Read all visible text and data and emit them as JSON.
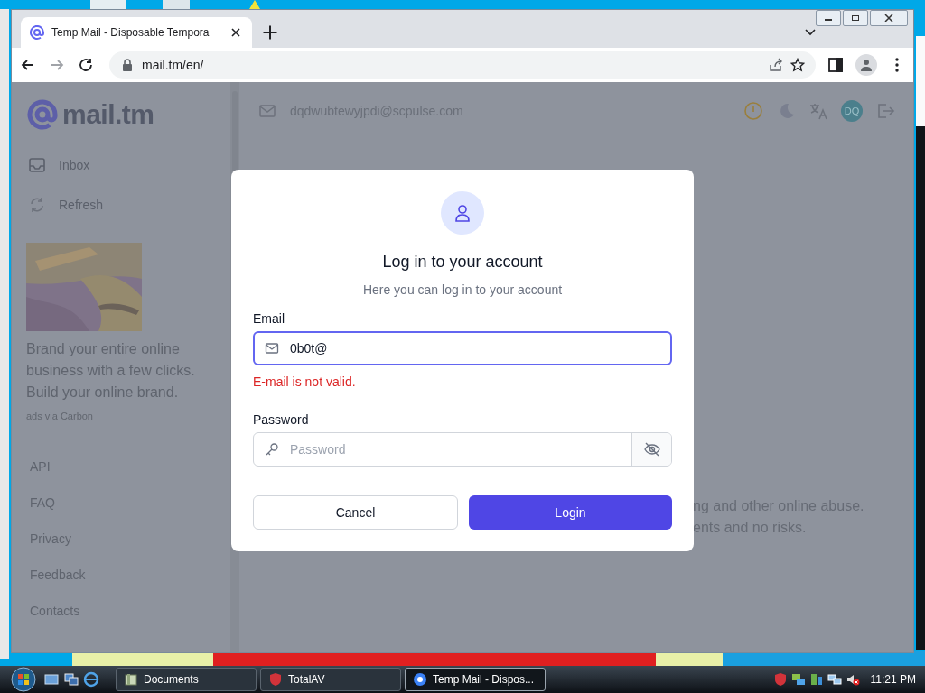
{
  "browser": {
    "tab_title": "Temp Mail - Disposable Tempora",
    "url": "mail.tm/en/"
  },
  "sidebar": {
    "logo": "mail.tm",
    "nav": [
      {
        "label": "Inbox",
        "kind": "inbox"
      },
      {
        "label": "Refresh",
        "kind": "refresh"
      }
    ],
    "ad": {
      "kind": "picture",
      "text": "Brand your entire online business with a few clicks. Build your online brand.",
      "credit": "ads via Carbon"
    },
    "links": [
      "API",
      "FAQ",
      "Privacy",
      "Feedback",
      "Contacts"
    ]
  },
  "header": {
    "email": "dqdwubtewyjpdi@scpulse.com",
    "avatar": "DQ"
  },
  "background_text": [
    "ng and other online abuse.",
    "ents and no risks."
  ],
  "dialog": {
    "title": "Log in to your account",
    "subtitle": "Here you can log in to your account",
    "email": {
      "label": "Email",
      "value": "0b0t@",
      "error": "E-mail is not valid."
    },
    "password": {
      "label": "Password",
      "placeholder": "Password"
    },
    "cancel": "Cancel",
    "login": "Login"
  },
  "taskbar": {
    "tasks": [
      {
        "label": "Documents",
        "kind": "folder",
        "selected": false
      },
      {
        "label": "TotalAV",
        "kind": "shield",
        "selected": false
      },
      {
        "label": "Temp Mail - Dispos...",
        "kind": "browser",
        "selected": true
      }
    ],
    "clock": "11:21 PM"
  }
}
